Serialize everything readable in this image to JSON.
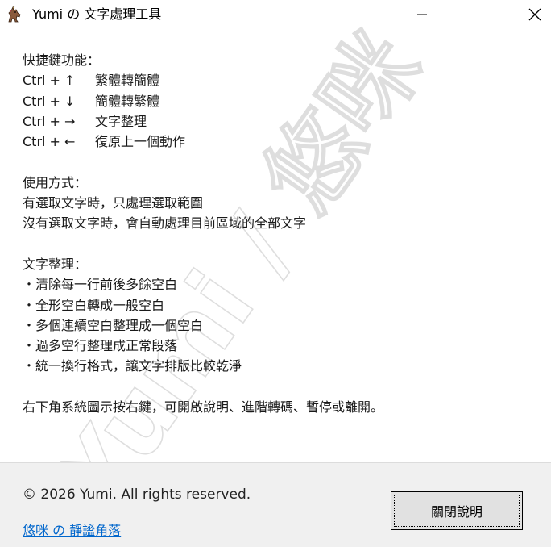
{
  "window": {
    "title": "Yumi の 文字處理工具",
    "icons": {
      "app": "unicorn-app-icon",
      "minimize": "minimize-icon",
      "maximize": "maximize-icon",
      "close": "close-icon"
    }
  },
  "shortcuts": {
    "heading": "快捷鍵功能：",
    "items": [
      {
        "key": "Ctrl + ↑",
        "action": "繁體轉簡體"
      },
      {
        "key": "Ctrl + ↓",
        "action": "簡體轉繁體"
      },
      {
        "key": "Ctrl + →",
        "action": "文字整理"
      },
      {
        "key": "Ctrl + ←",
        "action": "復原上一個動作"
      }
    ]
  },
  "usage": {
    "heading": "使用方式：",
    "lines": [
      "有選取文字時，只處理選取範圍",
      "沒有選取文字時，會自動處理目前區域的全部文字"
    ]
  },
  "cleanup": {
    "heading": "文字整理：",
    "items": [
      "・清除每一行前後多餘空白",
      "・全形空白轉成一般空白",
      "・多個連續空白整理成一個空白",
      "・過多空行整理成正常段落",
      "・統一換行格式，讓文字排版比較乾淨"
    ]
  },
  "tray_note": "右下角系統圖示按右鍵，可開啟說明、進階轉碼、暫停或離開。",
  "watermark": {
    "text": "Yumi / 悠咪"
  },
  "footer": {
    "copyright": "© 2026 Yumi. All rights reserved.",
    "link_text": "悠咪 の 靜謐角落",
    "close_button": "關閉說明"
  },
  "colors": {
    "link": "#0066cc",
    "footer_bg": "#f0f0f0",
    "button_bg": "#e1e1e1"
  }
}
